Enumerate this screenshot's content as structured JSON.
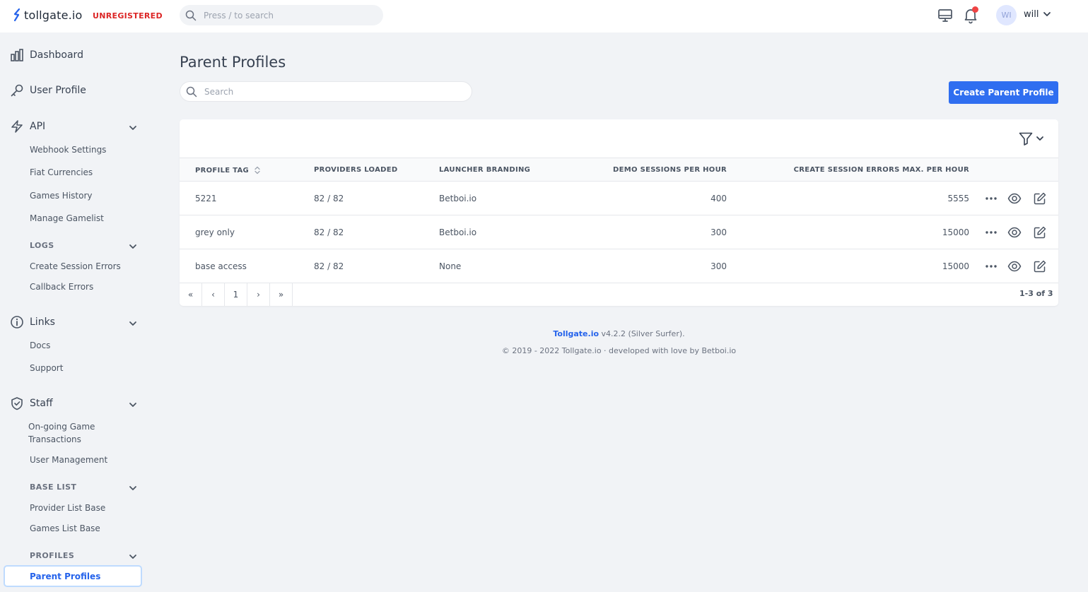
{
  "header": {
    "logo_text": "tollgate.io",
    "status": "UNREGISTERED",
    "search_placeholder": "Press / to search",
    "user_initials": "WI",
    "user_name": "will"
  },
  "sidebar": {
    "dashboard": "Dashboard",
    "user_profile": "User Profile",
    "api": "API",
    "api_items": [
      "Webhook Settings",
      "Fiat Currencies",
      "Games History",
      "Manage Gamelist"
    ],
    "logs": "LOGS",
    "logs_items": [
      "Create Session Errors",
      "Callback Errors"
    ],
    "links": "Links",
    "links_items": [
      "Docs",
      "Support"
    ],
    "staff": "Staff",
    "staff_items": [
      "On-going Game",
      "Transactions",
      "User Management"
    ],
    "base_list": "BASE LIST",
    "base_items": [
      "Provider List Base",
      "Games List Base"
    ],
    "profiles": "PROFILES",
    "profiles_items": [
      "Parent Profiles"
    ]
  },
  "main": {
    "title": "Parent Profiles",
    "search_placeholder": "Search",
    "create_button": "Create Parent Profile",
    "columns": [
      "PROFILE TAG",
      "PROVIDERS LOADED",
      "LAUNCHER BRANDING",
      "DEMO SESSIONS PER HOUR",
      "CREATE SESSION ERRORS MAX. PER HOUR"
    ],
    "rows": [
      [
        "5221",
        "82 / 82",
        "Betboi.io",
        "400",
        "5555"
      ],
      [
        "grey only",
        "82 / 82",
        "Betboi.io",
        "300",
        "15000"
      ],
      [
        "base access",
        "82 / 82",
        "None",
        "300",
        "15000"
      ]
    ],
    "pager": [
      "«",
      "‹",
      "1",
      "›",
      "»"
    ],
    "count": "1-3 of 3"
  },
  "footer": {
    "brand": "Tollgate.io",
    "version": " v4.2.2 (Silver Surfer).",
    "copyright": "© 2019 - 2022 Tollgate.io · developed with love by Betboi.io"
  },
  "colors": {
    "accent": "#2f6ef0",
    "status_red": "#dc2626",
    "background": "#f1f3f6"
  }
}
